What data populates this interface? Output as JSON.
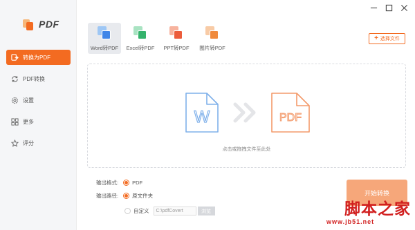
{
  "app": {
    "logo_text": "PDF"
  },
  "window": {
    "minimize": "—",
    "maximize": "□",
    "close": "✕"
  },
  "sidebar": {
    "items": [
      {
        "label": "转换为PDF",
        "icon": "convert-icon",
        "active": true
      },
      {
        "label": "PDF转换",
        "icon": "refresh-icon",
        "active": false
      },
      {
        "label": "设置",
        "icon": "gear-icon",
        "active": false
      },
      {
        "label": "更多",
        "icon": "grid-icon",
        "active": false
      },
      {
        "label": "评分",
        "icon": "star-icon",
        "active": false
      }
    ]
  },
  "tools": [
    {
      "label": "Word转PDF",
      "icon": "word-icon",
      "back": "#9ec7f5",
      "front": "#3f86e8",
      "active": true
    },
    {
      "label": "Excel转PDF",
      "icon": "excel-icon",
      "back": "#a9e3c2",
      "front": "#34b36c",
      "active": false
    },
    {
      "label": "PPT转PDF",
      "icon": "ppt-icon",
      "back": "#f7b39e",
      "front": "#ec5c3b",
      "active": false
    },
    {
      "label": "图片转PDF",
      "icon": "image-icon",
      "back": "#f8cba6",
      "front": "#f08a3c",
      "active": false
    }
  ],
  "select_file": {
    "label": "选择文件"
  },
  "dropzone": {
    "hint": "点击或拖拽文件至此处",
    "source_letter": "W",
    "target_text": "PDF"
  },
  "options": {
    "format_label": "输出格式:",
    "format_value": "PDF",
    "path_label": "输出路径:",
    "path_original": "原文件夹",
    "path_custom": "自定义",
    "path_value": "C:\\pdfCovert",
    "browse_label": "浏览"
  },
  "start_button": {
    "label": "开始转换"
  },
  "watermark": {
    "title": "脚本之家",
    "url": "www.jb51.net"
  },
  "colors": {
    "accent": "#f36b21",
    "word_blue": "#7fb0ea",
    "pdf_orange": "#f39a6b"
  }
}
